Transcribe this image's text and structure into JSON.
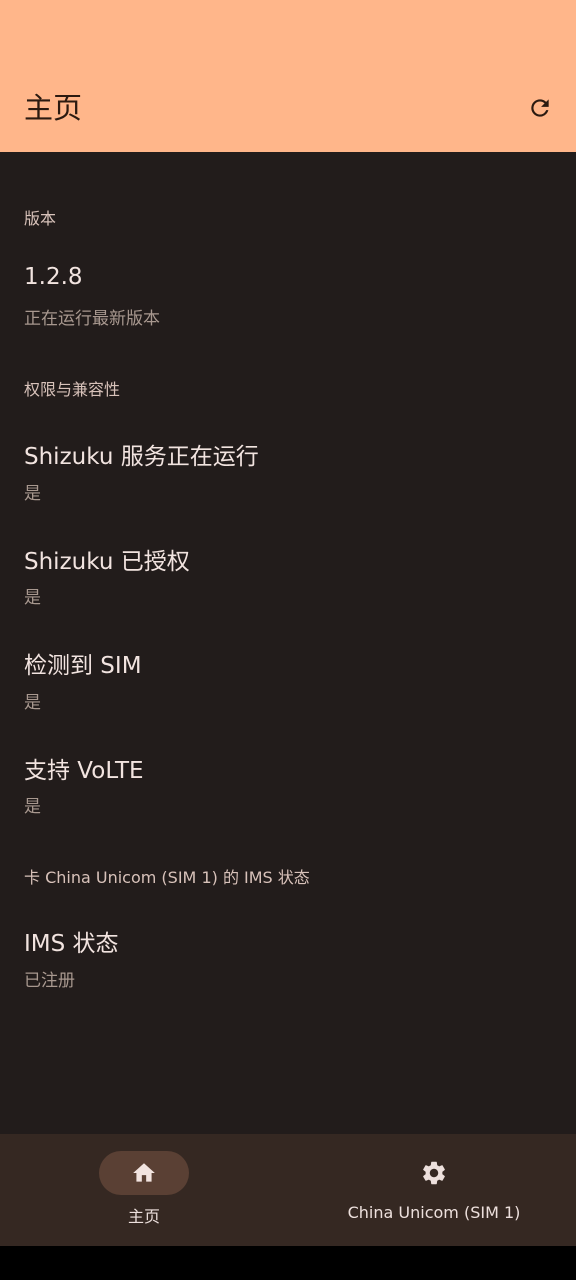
{
  "appbar": {
    "title": "主页",
    "refresh_icon": "refresh-icon"
  },
  "sections": {
    "version": {
      "header": "版本",
      "value": "1.2.8",
      "status": "正在运行最新版本"
    },
    "permissions": {
      "header": "权限与兼容性",
      "items": [
        {
          "title": "Shizuku 服务正在运行",
          "value": "是"
        },
        {
          "title": "Shizuku 已授权",
          "value": "是"
        },
        {
          "title": "检测到 SIM",
          "value": "是"
        },
        {
          "title": "支持 VoLTE",
          "value": "是"
        }
      ]
    },
    "ims": {
      "header": "卡 China Unicom (SIM 1) 的 IMS 状态",
      "title": "IMS 状态",
      "value": "已注册"
    }
  },
  "bottom_nav": {
    "items": [
      {
        "label": "主页",
        "icon": "home-icon",
        "active": true
      },
      {
        "label": "China Unicom (SIM 1)",
        "icon": "gear-icon",
        "active": false
      }
    ]
  },
  "colors": {
    "appbar_bg": "#ffb68a",
    "page_bg": "#221c1b",
    "nav_bg": "#352822",
    "active_pill": "#5a4034"
  }
}
